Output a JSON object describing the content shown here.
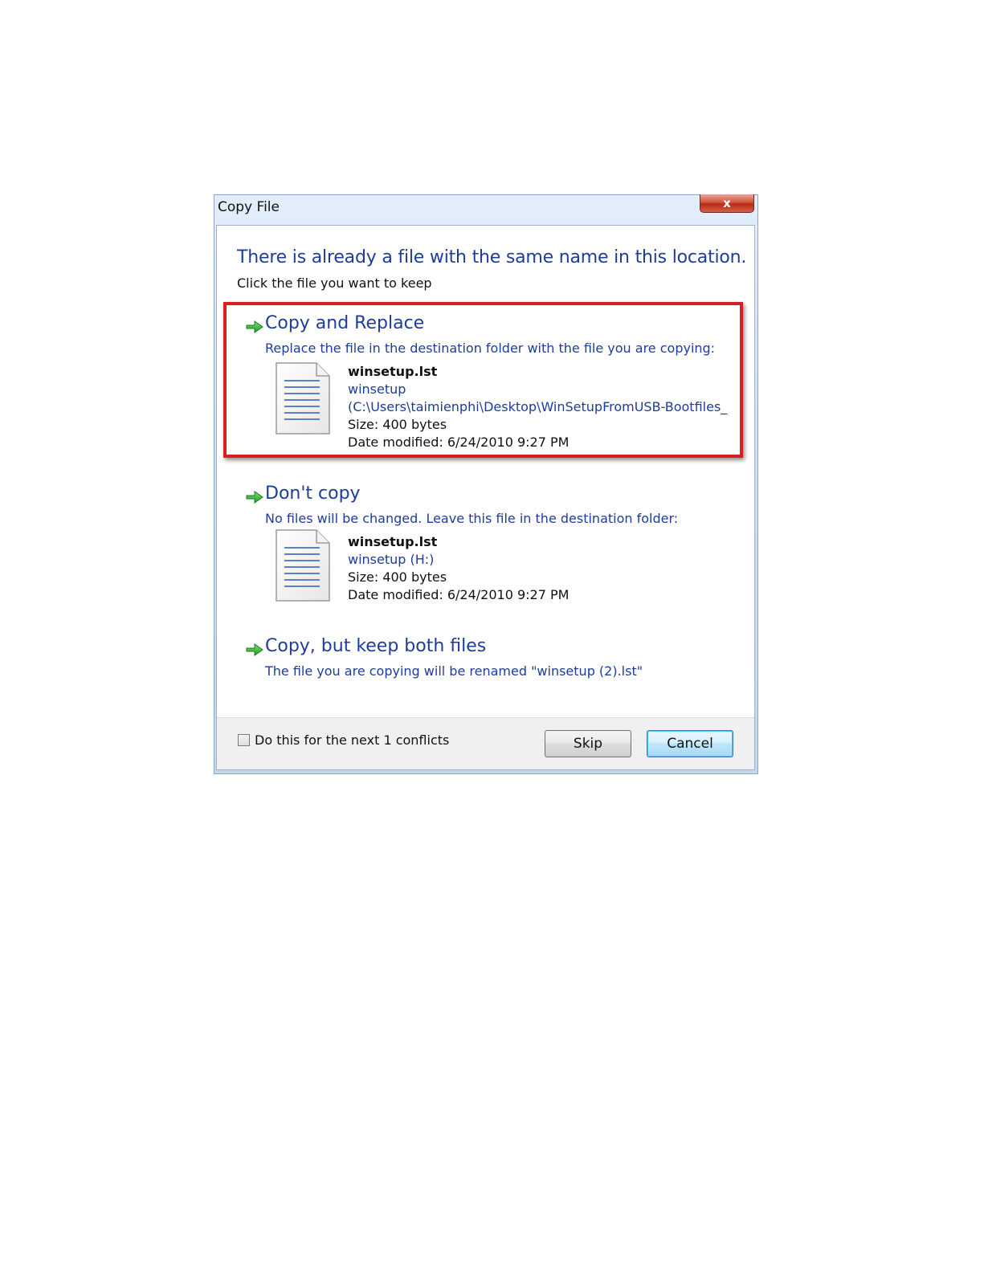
{
  "window": {
    "title": "Copy File",
    "close_label": "x"
  },
  "header": {
    "headline": "There is already a file with the same name in this location.",
    "subhead": "Click the file you want to keep"
  },
  "options": [
    {
      "title": "Copy and Replace",
      "description": "Replace the file in the destination folder with the file you are copying:",
      "file": {
        "name": "winsetup.lst",
        "folder": "winsetup",
        "path": "(C:\\Users\\taimienphi\\Desktop\\WinSetupFromUSB-Bootfiles_",
        "size": "Size: 400 bytes",
        "modified": "Date modified: 6/24/2010 9:27 PM"
      },
      "highlighted": true
    },
    {
      "title": "Don't copy",
      "description": "No files will be changed. Leave this file in the destination folder:",
      "file": {
        "name": "winsetup.lst",
        "folder": "winsetup (H:)",
        "size": "Size: 400 bytes",
        "modified": "Date modified: 6/24/2010 9:27 PM"
      }
    },
    {
      "title": "Copy, but keep both files",
      "description": "The file you are copying will be renamed \"winsetup (2).lst\""
    }
  ],
  "footer": {
    "checkbox_label": "Do this for the next 1 conflicts",
    "checkbox_checked": false,
    "skip_label": "Skip",
    "cancel_label": "Cancel"
  },
  "colors": {
    "link_blue": "#1e3d9a",
    "arrow_green": "#2aa52a",
    "highlight_red": "#d81e1e"
  },
  "icons": [
    "close-icon",
    "green-arrow-icon",
    "document-icon",
    "checkbox-icon"
  ]
}
